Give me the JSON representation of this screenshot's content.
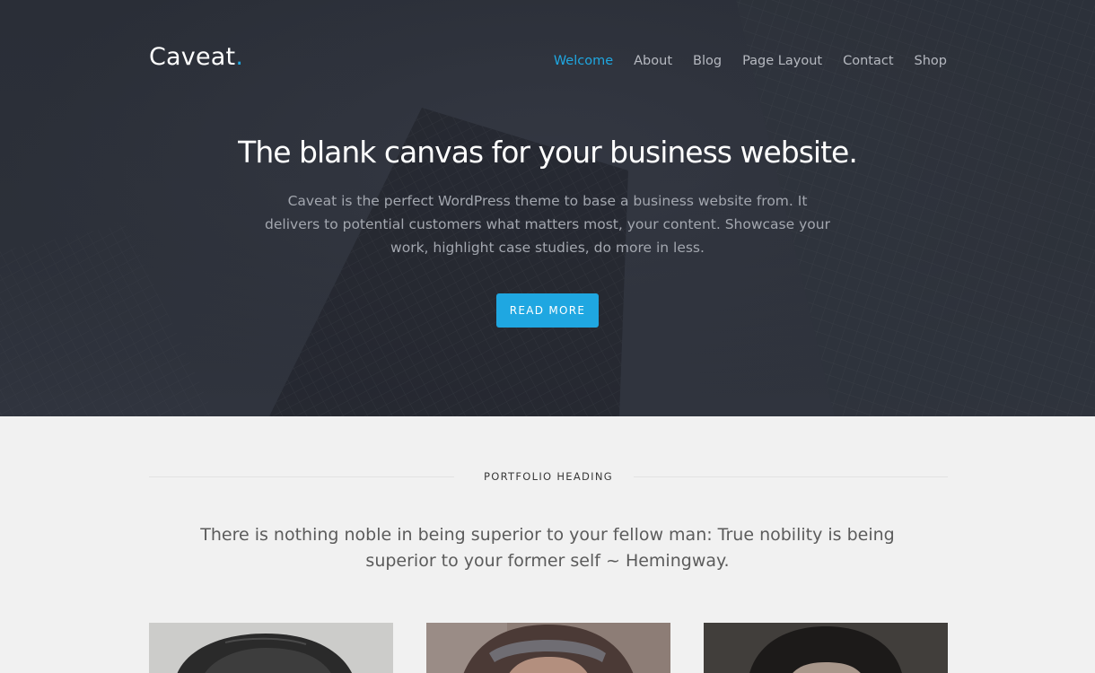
{
  "header": {
    "logo_text": "Caveat",
    "logo_dot": ".",
    "nav": [
      {
        "label": "Welcome",
        "active": true
      },
      {
        "label": "About",
        "active": false
      },
      {
        "label": "Blog",
        "active": false
      },
      {
        "label": "Page Layout",
        "active": false
      },
      {
        "label": "Contact",
        "active": false
      },
      {
        "label": "Shop",
        "active": false
      }
    ]
  },
  "hero": {
    "title": "The blank canvas for your business website.",
    "text": "Caveat is the perfect WordPress theme to base a business website from. It delivers to potential customers what matters most, your content. Showcase your work, highlight case studies, do more in less.",
    "button_label": "READ MORE"
  },
  "portfolio": {
    "heading": "PORTFOLIO HEADING",
    "quote": "There is nothing noble in being superior to your fellow man: True nobility is being superior to your former self ~ Hemingway.",
    "items": [
      {
        "icon": "portrait-photo-hat"
      },
      {
        "icon": "portrait-photo-bandana"
      },
      {
        "icon": "portrait-photo-dark-hair"
      }
    ]
  },
  "colors": {
    "accent": "#1fa7e1",
    "hero_bg": "#2c3039",
    "page_bg": "#f1f1f1"
  }
}
